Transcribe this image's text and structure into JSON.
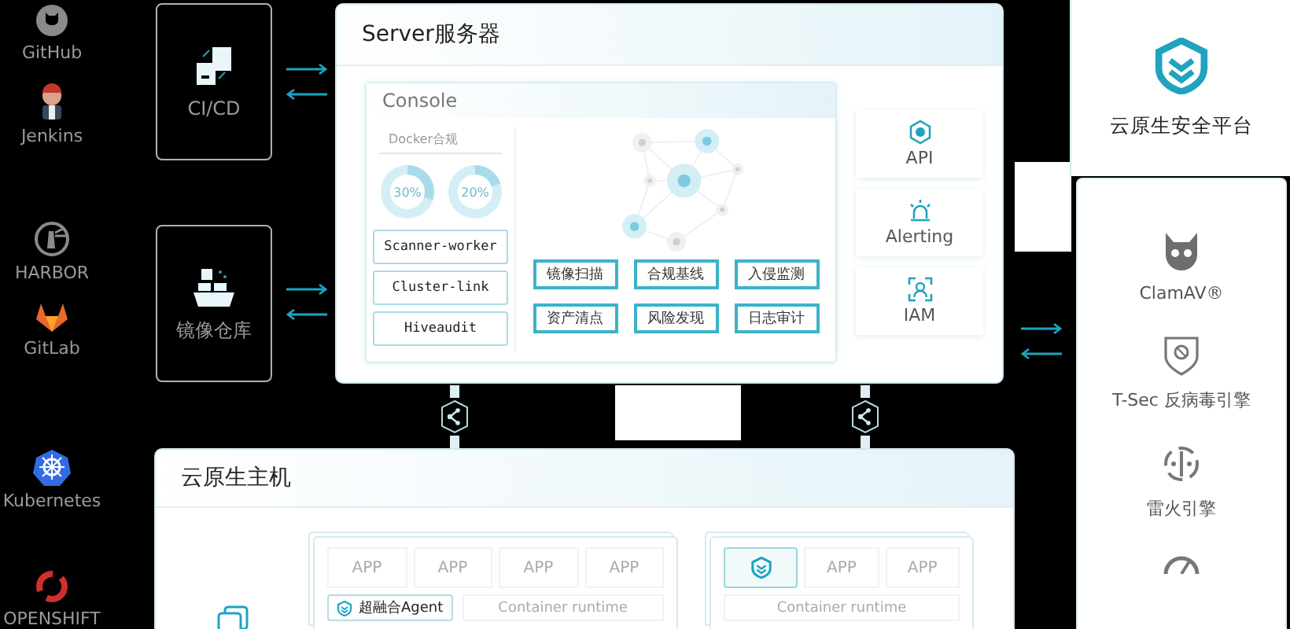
{
  "sources": [
    {
      "label": "GitHub",
      "kind": "github"
    },
    {
      "label": "Jenkins",
      "kind": "jenkins"
    },
    {
      "label": "HARBOR",
      "kind": "harbor"
    },
    {
      "label": "GitLab",
      "kind": "gitlab"
    },
    {
      "label": "Kubernetes",
      "kind": "kubernetes"
    },
    {
      "label": "OPENSHIFT",
      "kind": "openshift"
    }
  ],
  "pipeline": [
    {
      "label": "CI/CD",
      "kind": "cicd"
    },
    {
      "label": "镜像仓库",
      "kind": "registry"
    }
  ],
  "server": {
    "title": "Server服务器",
    "console": {
      "title": "Console",
      "docker_title": "Docker合规",
      "gauges": [
        {
          "label": "30%",
          "level": 0.3
        },
        {
          "label": "20%",
          "level": 0.2
        }
      ],
      "workers": [
        "Scanner-worker",
        "Cluster-link",
        "Hiveaudit"
      ],
      "features": [
        "镜像扫描",
        "合规基线",
        "入侵监测",
        "资产清点",
        "风险发现",
        "日志审计"
      ]
    },
    "services": [
      {
        "label": "API",
        "kind": "api"
      },
      {
        "label": "Alerting",
        "kind": "alerting"
      },
      {
        "label": "IAM",
        "kind": "iam"
      }
    ]
  },
  "platform": {
    "title": "云原生安全平台",
    "engines": [
      {
        "label": "ClamAV®",
        "kind": "clamav"
      },
      {
        "label": "T-Sec 反病毒引擎",
        "kind": "tsec"
      },
      {
        "label": "雷火引擎",
        "kind": "leihuo"
      },
      {
        "kind": "gauge"
      }
    ]
  },
  "host": {
    "title": "云原生主机",
    "groups": [
      {
        "slots": [
          {
            "kind": "app",
            "label": "APP"
          },
          {
            "kind": "app",
            "label": "APP"
          },
          {
            "kind": "app",
            "label": "APP"
          },
          {
            "kind": "app",
            "label": "APP"
          }
        ],
        "base": [
          {
            "kind": "agent",
            "label": "超融合Agent"
          },
          {
            "kind": "runtime",
            "label": "Container runtime"
          }
        ]
      },
      {
        "slots": [
          {
            "kind": "logo"
          },
          {
            "kind": "app",
            "label": "APP"
          },
          {
            "kind": "app",
            "label": "APP"
          }
        ],
        "base": [
          {
            "kind": "runtime",
            "label": "Container runtime"
          }
        ]
      }
    ]
  }
}
